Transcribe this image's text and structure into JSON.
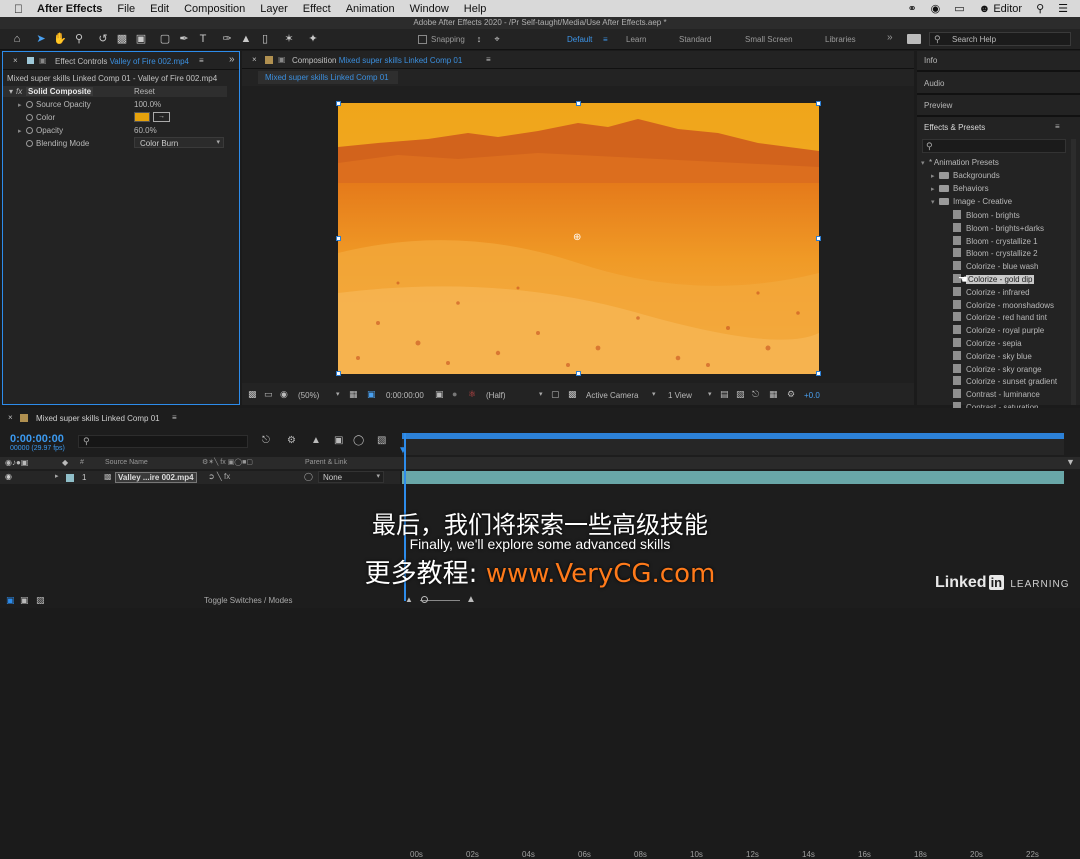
{
  "menubar": {
    "app_name": "After Effects",
    "items": [
      "File",
      "Edit",
      "Composition",
      "Layer",
      "Effect",
      "Animation",
      "Window",
      "Help"
    ],
    "right_label": "Editor"
  },
  "window_title": "Adobe After Effects 2020 - /Pr Self-taught/Media/Use After Effects.aep *",
  "toolbar": {
    "snapping_label": "Snapping",
    "workspaces": [
      "Default",
      "Learn",
      "Standard",
      "Small Screen",
      "Libraries"
    ],
    "search_placeholder": "Search Help"
  },
  "effect_controls": {
    "tab_prefix": "Effect Controls",
    "tab_layer": "Valley of Fire 002.mp4",
    "breadcrumb": "Mixed super skills Linked Comp 01 - Valley of Fire 002.mp4",
    "effect_name": "Solid Composite",
    "fx_label": "fx",
    "reset_label": "Reset",
    "props": [
      {
        "name": "Source Opacity",
        "value": "100.0%"
      },
      {
        "name": "Color",
        "value": ""
      },
      {
        "name": "Opacity",
        "value": "60.0%"
      },
      {
        "name": "Blending Mode",
        "value": "Color Burn"
      }
    ],
    "color_swatch": "#e6a20c"
  },
  "composition": {
    "tab_prefix": "Composition",
    "tab_name": "Mixed super skills Linked Comp 01",
    "sub_tab": "Mixed super skills Linked Comp 01",
    "footer": {
      "zoom": "(50%)",
      "timecode": "0:00:00:00",
      "resolution": "(Half)",
      "camera": "Active Camera",
      "view": "1 View",
      "exposure": "+0.0"
    }
  },
  "right_panel": {
    "sections": [
      "Info",
      "Audio",
      "Preview"
    ],
    "effects_title": "Effects & Presets",
    "tree_root": "* Animation Presets",
    "folders": [
      "Backgrounds",
      "Behaviors",
      "Image - Creative"
    ],
    "presets": [
      "Bloom - brights",
      "Bloom - brights+darks",
      "Bloom - crystallize 1",
      "Bloom - crystallize 2",
      "Colorize - blue wash",
      "Colorize - gold dip",
      "Colorize - infrared",
      "Colorize - moonshadows",
      "Colorize - red hand tint",
      "Colorize - royal purple",
      "Colorize - sepia",
      "Colorize - sky blue",
      "Colorize - sky orange",
      "Colorize - sunset gradient",
      "Contrast - luminance",
      "Contrast - saturation"
    ],
    "selected_preset": "Colorize - gold dip"
  },
  "timeline": {
    "tab_name": "Mixed super skills Linked Comp 01",
    "timecode": "0:00:00:00",
    "frame_info": "00000 (29.97 fps)",
    "col_source": "Source Name",
    "col_parent": "Parent & Link",
    "col_num": "#",
    "layer_num": "1",
    "layer_name": "Valley ...ire 002.mp4",
    "layer_parent": "None",
    "ruler": [
      "00s",
      "02s",
      "04s",
      "06s",
      "08s",
      "10s",
      "12s",
      "14s",
      "16s",
      "18s",
      "20s",
      "22s"
    ],
    "toggle_label": "Toggle Switches / Modes"
  },
  "overlay": {
    "subtitle_cn": "最后，我们将探索一些高级技能",
    "subtitle_en": "Finally, we'll explore some advanced skills",
    "promo_prefix": "更多教程: ",
    "promo_url": "www.VeryCG.com",
    "logo_text": "Linked",
    "logo_in": "in",
    "logo_suffix": "LEARNING"
  },
  "colors": {
    "accent": "#2d8ceb",
    "promo": "#ff7a1a",
    "selection": "#c9c9c9"
  }
}
